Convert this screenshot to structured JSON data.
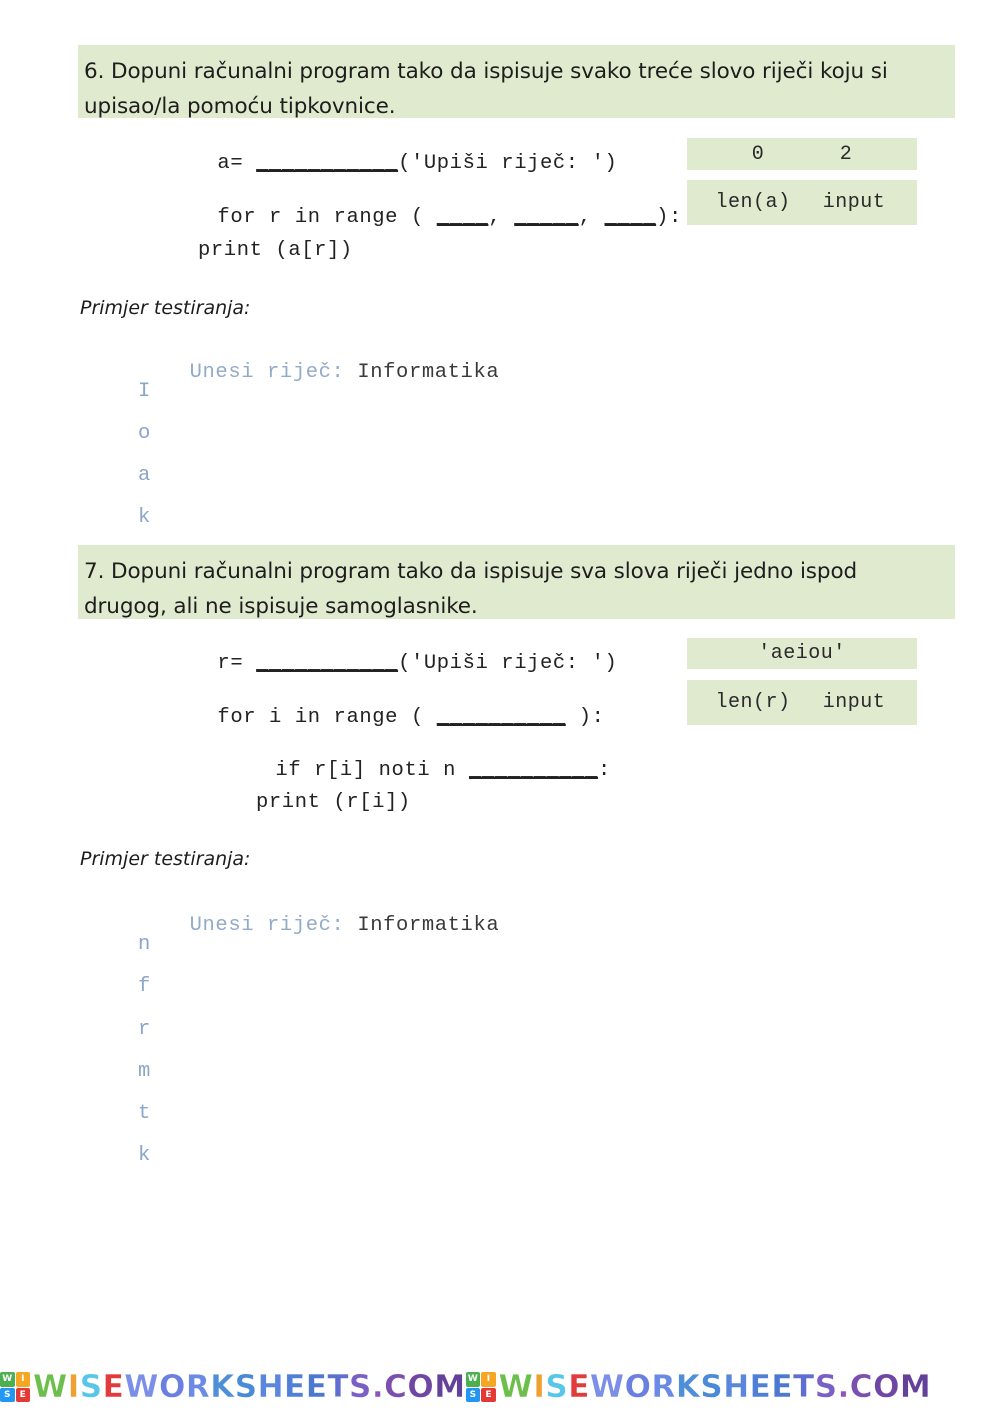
{
  "document": {
    "type": "worksheet",
    "language": "hr",
    "background_color": "#ffffff",
    "heading_band_color": "#dfeacf",
    "hint_box_color": "#dfeacf",
    "code_text_color": "#222222",
    "output_prompt_color": "#93abc9",
    "output_char_color": "#8aa6c8"
  },
  "questions": [
    {
      "number": "6",
      "heading_line_1": "6. Dopuni računalni program tako da ispisuje svako treće slovo riječi koju si",
      "heading_line_2": "upisao/la pomoću tipkovnice.",
      "code": {
        "line_1_prefix": "a= ",
        "line_1_blank": "___________",
        "line_1_suffix": "('Upiši riječ: ')",
        "line_2_prefix": "for r in range ( ",
        "line_2_blank_1": "____",
        "line_2_sep_1": ", ",
        "line_2_blank_2": "_____",
        "line_2_sep_2": ", ",
        "line_2_blank_3": "____",
        "line_2_suffix": "):",
        "line_3": "print (a[r])"
      },
      "hints": {
        "row_1": [
          "0",
          "2"
        ],
        "row_2": [
          "len(a)",
          "input"
        ]
      },
      "sample_label": "Primjer testiranja:",
      "sample": {
        "prompt": "Unesi riječ: ",
        "typed": "Informatika",
        "output_chars": [
          "I",
          "o",
          "a",
          "k"
        ]
      }
    },
    {
      "number": "7",
      "heading_line_1": "7. Dopuni računalni program tako da ispisuje sva slova riječi jedno ispod",
      "heading_line_2": "drugog, ali ne ispisuje samoglasnike.",
      "code": {
        "line_1_prefix": "r= ",
        "line_1_blank": "___________",
        "line_1_suffix": "('Upiši riječ: ')",
        "line_2_prefix": "for i in range ( ",
        "line_2_blank_1": "__________",
        "line_2_suffix": " ):",
        "line_3_prefix": "if r[i] noti n ",
        "line_3_blank": "__________",
        "line_3_suffix": ":",
        "line_4": "print (r[i])"
      },
      "hints": {
        "row_1": [
          "'aeiou'"
        ],
        "row_2": [
          "len(r)",
          "input"
        ]
      },
      "sample_label": "Primjer testiranja:",
      "sample": {
        "prompt": "Unesi riječ: ",
        "typed": "Informatika",
        "output_chars": [
          "n",
          "f",
          "r",
          "m",
          "t",
          "k"
        ]
      }
    }
  ],
  "footer": {
    "watermark_text": "WISEWORKSHEETS.COM",
    "logo_letters": [
      "W",
      "I",
      "S",
      "E"
    ],
    "logo_colors": [
      "#4caf50",
      "#f5a623",
      "#2196f3",
      "#e53935"
    ],
    "letter_colors": [
      "#6dbf4b",
      "#f0a030",
      "#58c6e8",
      "#e23b3b",
      "#7b8ee8",
      "#6a7fe0",
      "#6a8ae6",
      "#4f8fd8",
      "#4a8ad6",
      "#5a86dd",
      "#4f7fd6",
      "#4b79d2",
      "#5f6fcf",
      "#7a5fc4",
      "#8b55bd",
      "#7b4fae",
      "#6f47a3",
      "#63409a"
    ]
  }
}
